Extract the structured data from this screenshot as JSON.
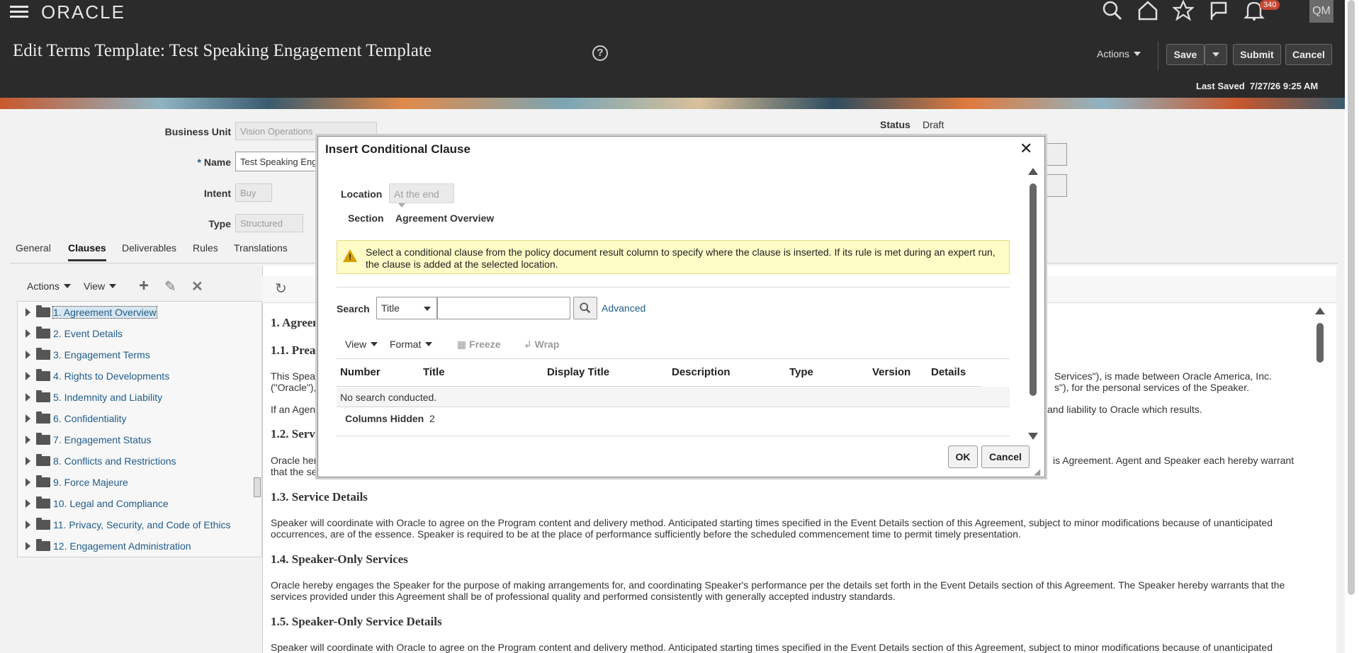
{
  "header": {
    "logo": "ORACLE",
    "notification_count": "340",
    "avatar_initials": "QM",
    "page_title": "Edit Terms Template: Test Speaking Engagement Template",
    "actions_label": "Actions",
    "save_label": "Save",
    "submit_label": "Submit",
    "cancel_label": "Cancel",
    "last_saved_label": "Last Saved",
    "last_saved_value": "7/27/26 9:25 AM"
  },
  "form": {
    "business_unit_label": "Business Unit",
    "business_unit_value": "Vision Operations",
    "name_label": "Name",
    "name_required": "*",
    "name_value": "Test Speaking Engagement Template",
    "intent_label": "Intent",
    "intent_value": "Buy",
    "type_label": "Type",
    "type_value": "Structured",
    "status_label": "Status",
    "status_value": "Draft"
  },
  "tabs": [
    "General",
    "Clauses",
    "Deliverables",
    "Rules",
    "Translations"
  ],
  "tree_toolbar": {
    "actions": "Actions",
    "view": "View"
  },
  "tree": [
    "1. Agreement Overview",
    "2. Event Details",
    "3. Engagement Terms",
    "4. Rights to Developments",
    "5. Indemnity and Liability",
    "6. Confidentiality",
    "7. Engagement Status",
    "8. Conflicts and Restrictions",
    "9. Force Majeure",
    "10. Legal and Compliance",
    "11. Privacy, Security, and Code of Ethics",
    "12. Engagement Administration"
  ],
  "content": {
    "h1": "1. Agreem",
    "h11": "1.1. Prea",
    "p11a_left": "This Spea",
    "p11a_right": "Services\"), is made between Oracle America, Inc.",
    "p11b_left": "(\"Oracle\"),",
    "p11b_right": "s\"), for the personal services of the Speaker.",
    "p11c_left": "If an Agen",
    "p11c_right": "and liability to Oracle which results.",
    "h12": "1.2. Serv",
    "p12a_left": "Oracle her",
    "p12a_right": "is Agreement. Agent and Speaker each hereby warrant",
    "p12b_left": "that the se",
    "h13": "1.3. Service Details",
    "p13": "Speaker will coordinate with Oracle to agree on the Program content and delivery method. Anticipated starting times specified in the Event Details section of this Agreement, subject to minor modifications because of unanticipated occurrences, are of the essence. Speaker is required to be at the place of performance sufficiently before the scheduled commencement time to permit timely presentation.",
    "h14": "1.4. Speaker-Only Services",
    "p14": "Oracle hereby engages the Speaker for the purpose of making arrangements for, and coordinating Speaker's performance per the details set forth in the Event Details section of this Agreement. The Speaker hereby warrants that the services provided under this Agreement shall be of professional quality and performed consistently with generally accepted industry standards.",
    "h15": "1.5. Speaker-Only Service Details",
    "p15": "Speaker will coordinate with Oracle to agree on the Program content and delivery method. Anticipated starting times specified in the Event Details section of this Agreement, subject to minor modifications because of unanticipated"
  },
  "dialog": {
    "title": "Insert Conditional Clause",
    "location_label": "Location",
    "location_value": "At the end",
    "section_label": "Section",
    "section_value": "Agreement Overview",
    "warning_text": "Select a conditional clause from the policy document result column to specify where the clause is inserted. If its rule is met during an expert run, the clause is added at the selected location.",
    "search_label": "Search",
    "search_field": "Title",
    "search_value": "",
    "advanced_label": "Advanced",
    "view_label": "View",
    "format_label": "Format",
    "freeze_label": "Freeze",
    "wrap_label": "Wrap",
    "columns": [
      "Number",
      "Title",
      "Display Title",
      "Description",
      "Type",
      "Version",
      "Details"
    ],
    "empty_text": "No search conducted.",
    "columns_hidden_label": "Columns Hidden",
    "columns_hidden_value": "2",
    "ok_label": "OK",
    "cancel_label": "Cancel"
  }
}
